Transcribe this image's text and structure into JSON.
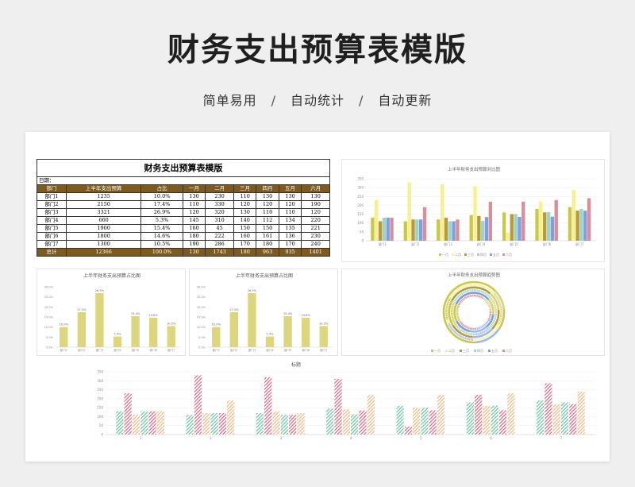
{
  "hero": {
    "title": "财务支出预算表模版",
    "features": [
      "简单易用",
      "自动统计",
      "自动更新"
    ],
    "separator": "/"
  },
  "table": {
    "title": "财务支出预算表模版",
    "date_label": "日期：",
    "headers": [
      "部门",
      "上半年支出预算",
      "占比",
      "一月",
      "二月",
      "三月",
      "四月",
      "五月",
      "六月"
    ],
    "rows": [
      [
        "部门1",
        "1235",
        "10.0%",
        "130",
        "230",
        "110",
        "130",
        "130",
        "130"
      ],
      [
        "部门2",
        "2150",
        "17.4%",
        "110",
        "330",
        "120",
        "120",
        "120",
        "190"
      ],
      [
        "部门3",
        "3321",
        "26.9%",
        "120",
        "320",
        "130",
        "110",
        "110",
        "120"
      ],
      [
        "部门4",
        "660",
        "5.3%",
        "145",
        "310",
        "140",
        "112",
        "134",
        "220"
      ],
      [
        "部门5",
        "1900",
        "15.4%",
        "160",
        "45",
        "150",
        "150",
        "135",
        "221"
      ],
      [
        "部门6",
        "1800",
        "14.6%",
        "180",
        "222",
        "160",
        "161",
        "136",
        "230"
      ],
      [
        "部门7",
        "1300",
        "10.5%",
        "190",
        "286",
        "170",
        "180",
        "170",
        "240"
      ]
    ],
    "total": [
      "总计",
      "12366",
      "100.0%",
      "130",
      "1743",
      "180",
      "963",
      "935",
      "1401"
    ]
  },
  "chart_data": [
    {
      "type": "bar",
      "title": "上半年财务支出预算对比图",
      "categories": [
        "部门1",
        "部门2",
        "部门3",
        "部门4",
        "部门5",
        "部门6",
        "部门7"
      ],
      "series": [
        {
          "name": "一月",
          "values": [
            130,
            110,
            120,
            145,
            160,
            180,
            190
          ],
          "color": "#c9c84a"
        },
        {
          "name": "二月",
          "values": [
            230,
            330,
            320,
            310,
            45,
            222,
            286
          ],
          "color": "#f6f08f"
        },
        {
          "name": "三月",
          "values": [
            110,
            120,
            130,
            140,
            150,
            160,
            170
          ],
          "color": "#b89a3c"
        },
        {
          "name": "四月",
          "values": [
            130,
            120,
            110,
            112,
            150,
            161,
            180
          ],
          "color": "#9fd4c4"
        },
        {
          "name": "五月",
          "values": [
            130,
            120,
            110,
            134,
            135,
            136,
            170
          ],
          "color": "#7f9fe0"
        },
        {
          "name": "六月",
          "values": [
            130,
            190,
            120,
            220,
            221,
            230,
            240
          ],
          "color": "#d98f99"
        }
      ],
      "ylim": [
        0,
        350
      ],
      "yticks": [
        "0",
        "50",
        "100",
        "150",
        "200",
        "250",
        "300",
        "350"
      ],
      "legend": "bottom"
    },
    {
      "type": "bar",
      "title": "上半年财务支出预算占比图",
      "categories": [
        "部门1",
        "部门2",
        "部门3",
        "部门4",
        "部门5",
        "部门6",
        "部门7"
      ],
      "values": [
        10.0,
        17.4,
        26.9,
        5.3,
        15.4,
        14.6,
        10.5
      ],
      "data_labels": [
        "10.0%",
        "17.4%",
        "26.9%",
        "5.3%",
        "15.4%",
        "14.6%",
        "10.5%"
      ],
      "yticks": [
        "0.0%",
        "5.0%",
        "10.0%",
        "15.0%",
        "20.0%",
        "25.0%",
        "30.0%"
      ],
      "ylim": [
        0,
        30
      ],
      "color": "#dcd77e"
    },
    {
      "type": "bar",
      "title": "上半年财务支出预算占比图",
      "categories": [
        "部门1",
        "部门2",
        "部门3",
        "部门4",
        "部门5",
        "部门6",
        "部门7"
      ],
      "values": [
        10.0,
        17.4,
        26.9,
        5.3,
        15.4,
        14.6,
        10.5
      ],
      "data_labels": [
        "10.0%",
        "17.4%",
        "26.9%",
        "5.3%",
        "15.4%",
        "14.6%",
        "10.5%"
      ],
      "yticks": [
        "0.0%",
        "5.0%",
        "10.0%",
        "15.0%",
        "20.0%",
        "25.0%",
        "30.0%"
      ],
      "ylim": [
        0,
        30
      ],
      "color": "#dcd77e"
    },
    {
      "type": "pie",
      "title": "上半年财务支出预算趋势图",
      "legend": "bottom",
      "series": [
        {
          "name": "一月",
          "values": [
            130,
            110,
            120,
            145,
            160,
            180,
            190
          ],
          "color": "#c9c84a"
        },
        {
          "name": "二月",
          "values": [
            230,
            330,
            320,
            310,
            45,
            222,
            286
          ],
          "color": "#f6f08f"
        },
        {
          "name": "三月",
          "values": [
            110,
            120,
            130,
            140,
            150,
            160,
            170
          ],
          "color": "#b89a3c"
        },
        {
          "name": "四月",
          "values": [
            130,
            120,
            110,
            112,
            150,
            161,
            180
          ],
          "color": "#9fd4c4"
        },
        {
          "name": "五月",
          "values": [
            130,
            120,
            110,
            134,
            135,
            136,
            170
          ],
          "color": "#7f9fe0"
        },
        {
          "name": "六月",
          "values": [
            130,
            190,
            120,
            220,
            221,
            230,
            240
          ],
          "color": "#d98f99"
        }
      ]
    },
    {
      "type": "bar",
      "title": "标题",
      "categories": [
        "1",
        "2",
        "3",
        "4",
        "5",
        "6",
        "7"
      ],
      "series": [
        {
          "values": [
            130,
            110,
            120,
            145,
            160,
            180,
            190
          ],
          "color": "#5cc29a"
        },
        {
          "values": [
            230,
            330,
            320,
            310,
            45,
            222,
            286
          ],
          "color": "#e05a78"
        },
        {
          "values": [
            110,
            120,
            130,
            140,
            150,
            160,
            170
          ],
          "color": "#f0b27a"
        },
        {
          "values": [
            130,
            120,
            110,
            112,
            150,
            161,
            180
          ],
          "color": "#5cc29a"
        },
        {
          "values": [
            130,
            120,
            110,
            134,
            135,
            136,
            170
          ],
          "color": "#e05a78"
        },
        {
          "values": [
            130,
            190,
            120,
            220,
            221,
            230,
            240
          ],
          "color": "#f0b27a"
        }
      ],
      "ylim": [
        0,
        350
      ],
      "yticks": [
        "0",
        "50",
        "100",
        "150",
        "200",
        "250",
        "300",
        "350"
      ]
    }
  ]
}
